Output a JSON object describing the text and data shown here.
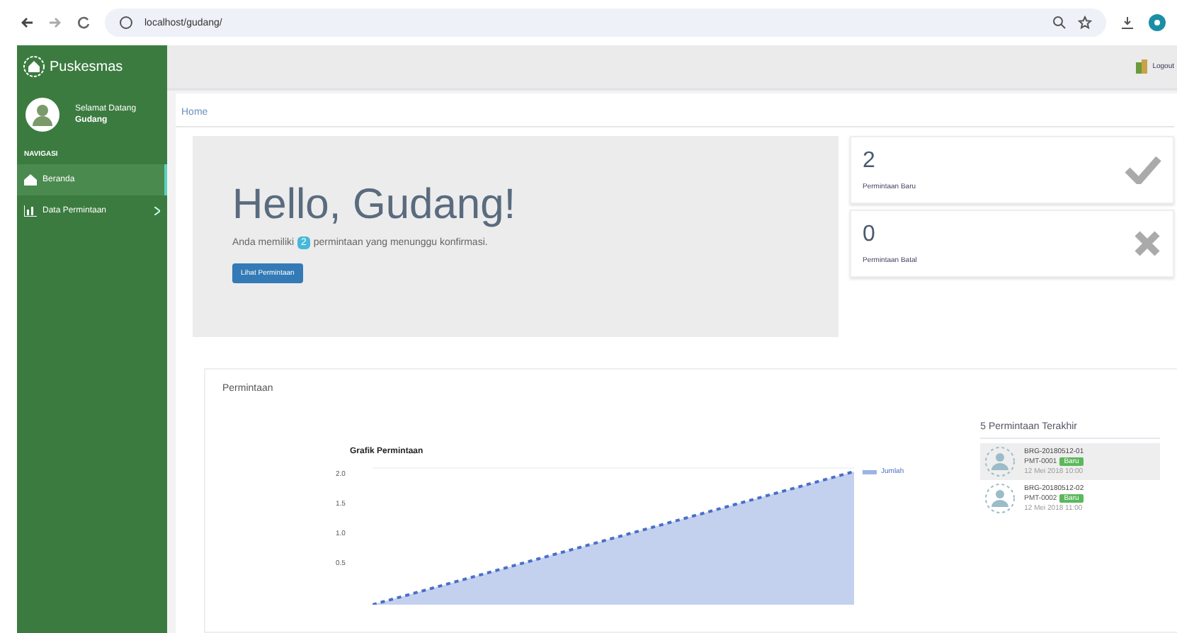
{
  "browser": {
    "url": "localhost/gudang/"
  },
  "sidebar": {
    "brand": "Puskesmas",
    "user": {
      "greeting": "Selamat Datang",
      "name": "Gudang"
    },
    "section": "NAVIGASI",
    "items": [
      {
        "label": "Beranda",
        "selected": true,
        "kind": "home",
        "expandable": false
      },
      {
        "label": "Data Permintaan",
        "selected": false,
        "kind": "chart",
        "expandable": true
      }
    ]
  },
  "header": {
    "user": "Logout"
  },
  "breadcrumb": "Home",
  "jumbotron": {
    "title": "Hello, Gudang!",
    "text_before": "Anda memiliki",
    "count": "2",
    "text_after": "permintaan yang menunggu konfirmasi.",
    "button": "Lihat Permintaan"
  },
  "stats": [
    {
      "value": "2",
      "label": "Permintaan Baru",
      "kind": "check"
    },
    {
      "value": "0",
      "label": "Permintaan Batal",
      "kind": "cross"
    }
  ],
  "panel": {
    "title": "Permintaan",
    "chart": {
      "title": "Grafik Permintaan",
      "legend": "Jumlah",
      "yticks": [
        "2.0",
        "1.5",
        "1.0",
        "0.5"
      ]
    },
    "recent": {
      "title": "5 Permintaan Terakhir",
      "items": [
        {
          "name": "BRG-20180512-01",
          "code": "PMT-0001",
          "status": "Baru",
          "date": "12 Mei 2018 10:00",
          "selected": true
        },
        {
          "name": "BRG-20180512-02",
          "code": "PMT-0002",
          "status": "Baru",
          "date": "12 Mei 2018 11:00",
          "selected": false
        }
      ]
    }
  }
}
